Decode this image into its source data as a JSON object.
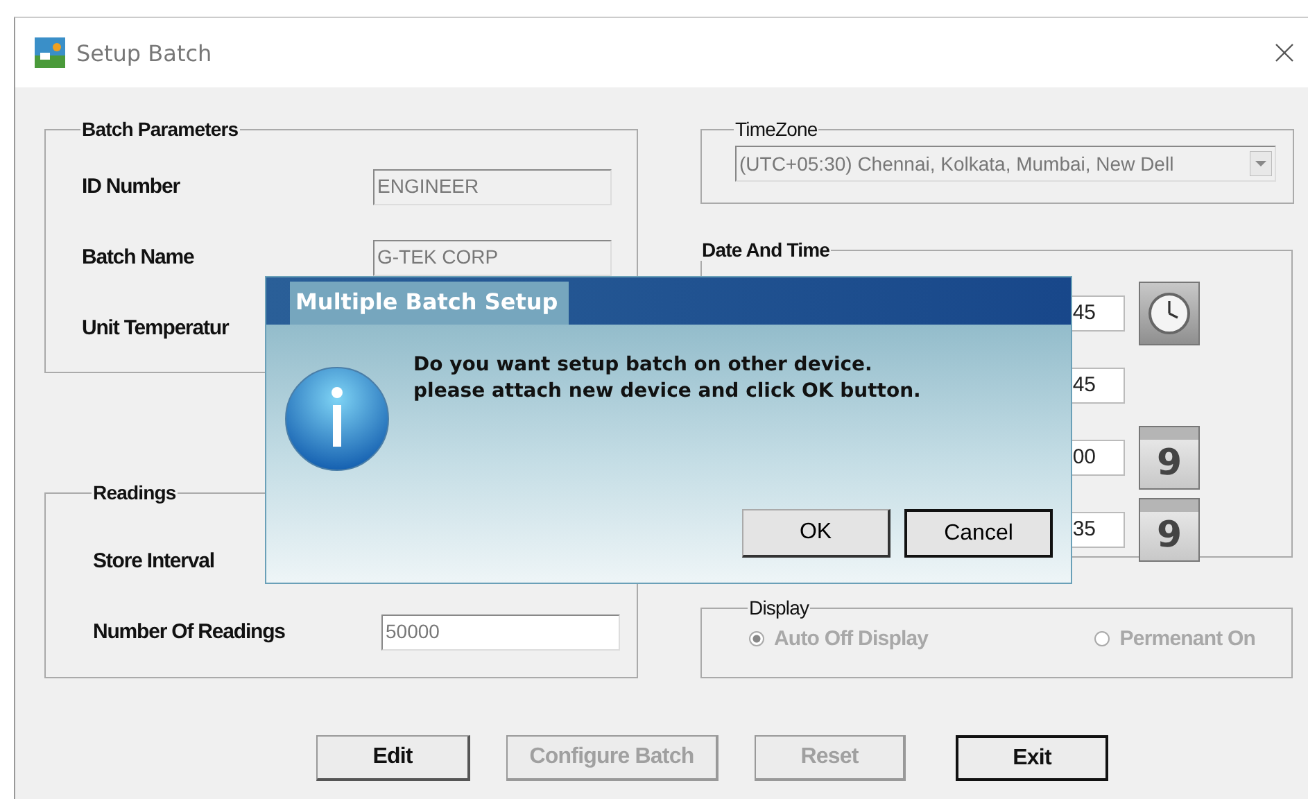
{
  "window": {
    "title": "Setup Batch"
  },
  "batch_parameters": {
    "title": "Batch Parameters",
    "fields": [
      {
        "label": "ID Number",
        "value": "ENGINEER",
        "disabled": true
      },
      {
        "label": "Batch Name",
        "value": "G-TEK CORP",
        "disabled": true
      },
      {
        "label": "Unit Temperatur"
      }
    ]
  },
  "readings": {
    "title": "Readings",
    "fields": [
      {
        "label": "Store Interval"
      },
      {
        "label": "Number Of Readings",
        "value": "50000",
        "disabled": false
      }
    ]
  },
  "timezone": {
    "title": "TimeZone",
    "value": "(UTC+05:30) Chennai, Kolkata, Mumbai, New Dell",
    "disabled": true
  },
  "date_and_time": {
    "title": "Date And Time",
    "rows": [
      {
        "value": "45",
        "kind": "clock"
      },
      {
        "value": "45",
        "kind": "none"
      },
      {
        "value": "00",
        "kind": "calendar",
        "day": "9"
      },
      {
        "value": "35",
        "kind": "calendar",
        "day": "9"
      }
    ]
  },
  "display": {
    "title": "Display",
    "disabled": true,
    "options": [
      {
        "label": "Auto Off Display",
        "selected": true
      },
      {
        "label": "Permenant On",
        "selected": false
      }
    ]
  },
  "buttons": [
    {
      "label": "Edit",
      "disabled": false,
      "default": false
    },
    {
      "label": "Configure Batch",
      "disabled": true,
      "default": false
    },
    {
      "label": "Reset",
      "disabled": true,
      "default": false
    },
    {
      "label": "Exit",
      "disabled": false,
      "default": true
    }
  ],
  "dialog": {
    "title": "Multiple Batch Setup",
    "message": [
      "Do you want setup batch on other device.",
      "please attach new device and click OK button."
    ],
    "buttons": [
      {
        "label": "OK",
        "default": false
      },
      {
        "label": "Cancel",
        "default": true
      }
    ]
  }
}
